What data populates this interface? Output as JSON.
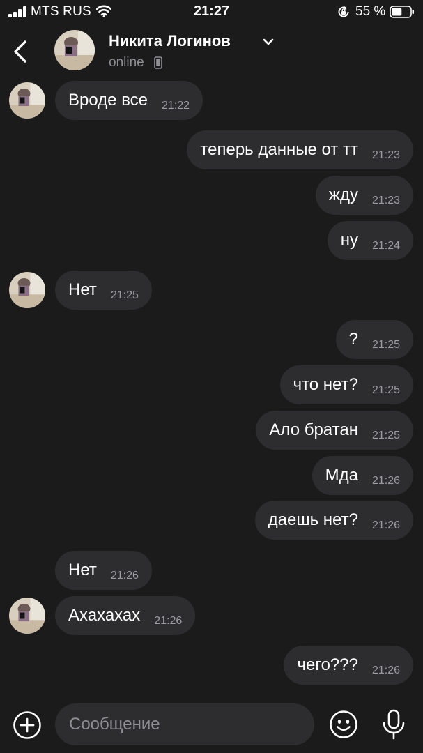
{
  "status_bar": {
    "carrier": "MTS RUS",
    "time": "21:27",
    "battery_percent": "55 %",
    "battery_level": 0.55
  },
  "header": {
    "contact_name": "Никита Логинов",
    "presence": "online",
    "icons": [
      "chevron-left-icon",
      "chevron-down-icon",
      "phone-icon"
    ]
  },
  "messages": [
    {
      "direction": "in",
      "text": "Вроде все",
      "time": "21:22",
      "avatar": true
    },
    {
      "direction": "out",
      "text": "теперь данные от тт",
      "time": "21:23"
    },
    {
      "direction": "out",
      "text": "жду",
      "time": "21:23"
    },
    {
      "direction": "out",
      "text": "ну",
      "time": "21:24"
    },
    {
      "direction": "in",
      "text": "Нет",
      "time": "21:25",
      "avatar": true
    },
    {
      "direction": "out",
      "text": "?",
      "time": "21:25"
    },
    {
      "direction": "out",
      "text": "что нет?",
      "time": "21:25"
    },
    {
      "direction": "out",
      "text": "Ало братан",
      "time": "21:25"
    },
    {
      "direction": "out",
      "text": "Мда",
      "time": "21:26"
    },
    {
      "direction": "out",
      "text": "даешь нет?",
      "time": "21:26"
    },
    {
      "direction": "in",
      "text": "Нет",
      "time": "21:26",
      "avatar": false
    },
    {
      "direction": "in",
      "text": "Ахахахах",
      "time": "21:26",
      "avatar": true
    },
    {
      "direction": "out",
      "text": "чего???",
      "time": "21:26"
    }
  ],
  "composer": {
    "placeholder": "Сообщение",
    "icons": [
      "plus-circle-icon",
      "emoji-icon",
      "microphone-icon"
    ]
  },
  "colors": {
    "background": "#1b1b1c",
    "bubble": "#2d2d2f",
    "text": "#ffffff",
    "secondary_text": "#8e8e93"
  }
}
